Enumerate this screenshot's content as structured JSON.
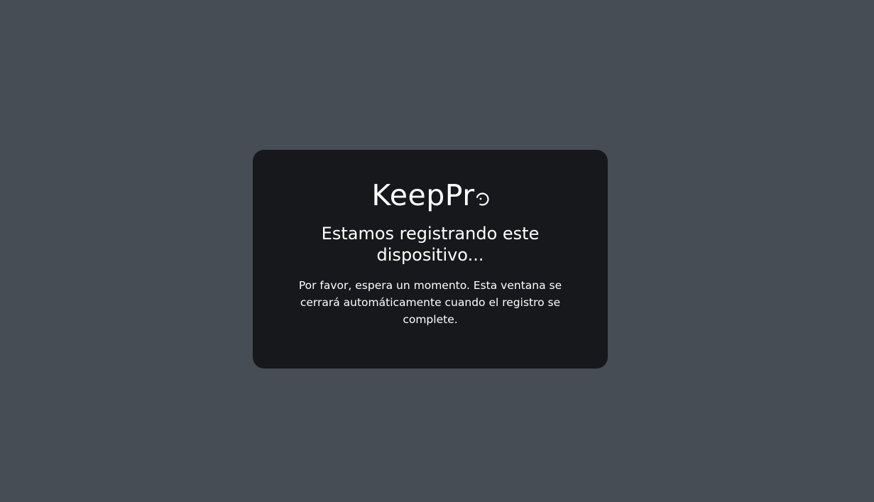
{
  "modal": {
    "logo": {
      "text": "KeepPr",
      "spinner_icon": "loading-spinner-icon"
    },
    "title": "Estamos registrando este dispositivo...",
    "message": "Por favor, espera un momento. Esta ventana se cerrará automáticamente cuando el registro se complete."
  },
  "colors": {
    "background": "#474d55",
    "modal_background": "#16181b",
    "text": "#ffffff"
  }
}
